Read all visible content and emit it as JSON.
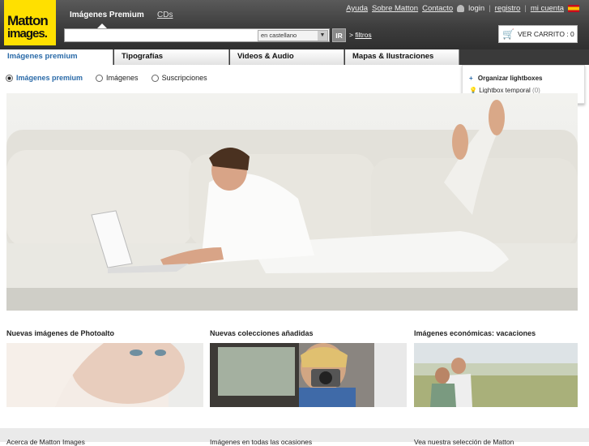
{
  "brand": {
    "logo_line1": "Matton",
    "logo_line2": "images."
  },
  "topnav": {
    "item1": "Imágenes Premium",
    "item2": "CDs"
  },
  "toplinks": {
    "help": "Ayuda",
    "about": "Sobre Matton",
    "contact": "Contacto",
    "login": "login",
    "register": "registro",
    "account": "mi cuenta"
  },
  "search": {
    "value": "",
    "language": "en castellano",
    "go": "IR",
    "filters_prefix": ">",
    "filters": "filtros"
  },
  "cart": {
    "label": "VER CARRITO : 0"
  },
  "tabs": [
    {
      "label": "Imágenes premium"
    },
    {
      "label": "Tipografías"
    },
    {
      "label": "Videos & Audio"
    },
    {
      "label": "Mapas & Ilustraciones"
    }
  ],
  "radios": [
    {
      "label": "Imágenes premium",
      "checked": true
    },
    {
      "label": "Imágenes",
      "checked": false
    },
    {
      "label": "Suscripciones",
      "checked": false
    }
  ],
  "lightbox": {
    "plus": "+",
    "organize": "Organizar lightboxes",
    "temp": "Lightbox temporal",
    "count": "(0)"
  },
  "sections": [
    {
      "title": "Nuevas imágenes de Photoalto"
    },
    {
      "title": "Nuevas colecciones añadidas"
    },
    {
      "title": "Imágenes económicas: vacaciones"
    }
  ],
  "footer": {
    "col1": "Acerca de Matton Images",
    "col2": "Imágenes en todas las ocasiones",
    "col3": "Vea nuestra selección de Matton"
  },
  "colors": {
    "accent": "#2a6aa8",
    "logo": "#ffe000",
    "header": "#3d3d3d"
  }
}
